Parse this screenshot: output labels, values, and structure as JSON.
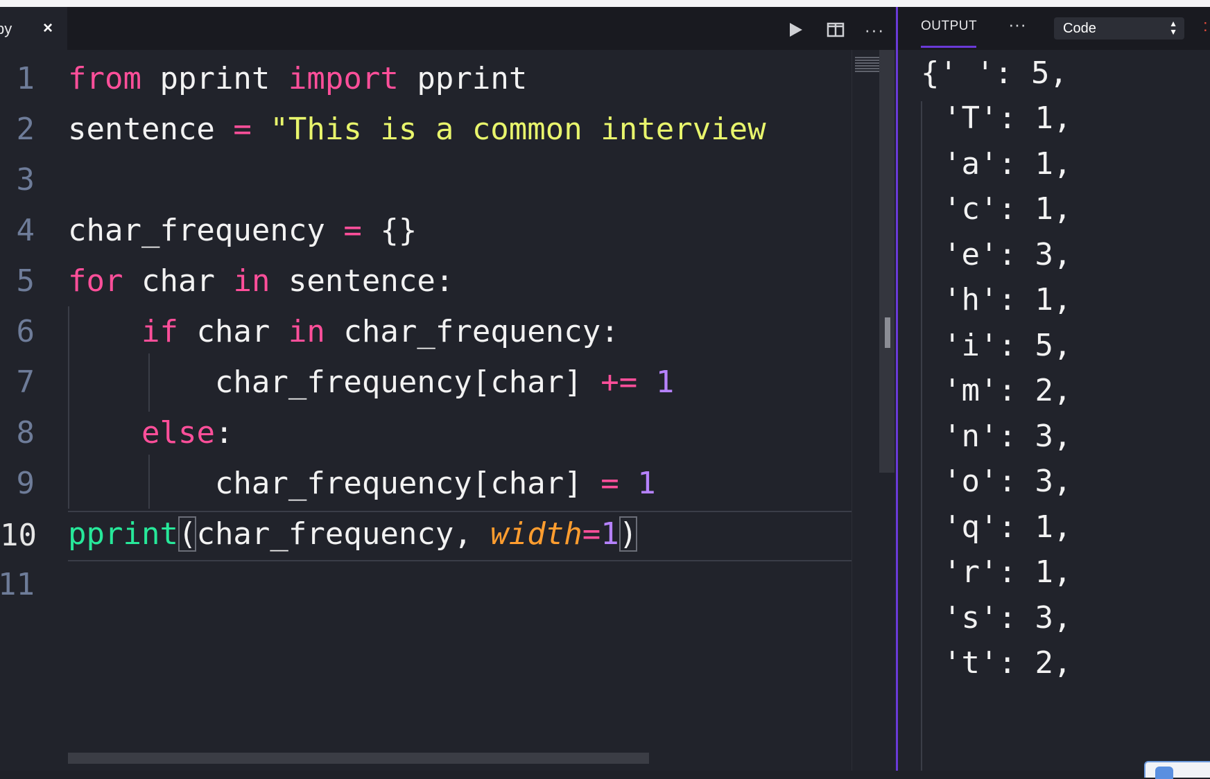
{
  "editor": {
    "tab": {
      "label": "py",
      "close_glyph": "×"
    },
    "toolbar": {
      "run_icon": "play-icon",
      "split_icon": "split-view-icon",
      "more_label": "···"
    },
    "lines": [
      {
        "n": "1"
      },
      {
        "n": "2"
      },
      {
        "n": "3"
      },
      {
        "n": "4"
      },
      {
        "n": "5"
      },
      {
        "n": "6"
      },
      {
        "n": "7"
      },
      {
        "n": "8"
      },
      {
        "n": "9"
      },
      {
        "n": "10"
      },
      {
        "n": "11"
      }
    ],
    "code": {
      "l1": {
        "from": "from",
        "mod": "pprint",
        "import": "import",
        "name": "pprint"
      },
      "l2": {
        "var": "sentence",
        "eq": "=",
        "str": "\"This is a common interview"
      },
      "l4": {
        "var": "char_frequency",
        "eq": "=",
        "rest": "{}"
      },
      "l5": {
        "for": "for",
        "var": "char",
        "in": "in",
        "iter": "sentence:"
      },
      "l6": {
        "if": "if",
        "var": "char",
        "in": "in",
        "obj": "char_frequency:"
      },
      "l7": {
        "target": "char_frequency[char]",
        "op": "+=",
        "num": "1"
      },
      "l8": {
        "else": "else",
        "colon": ":"
      },
      "l9": {
        "target": "char_frequency[char]",
        "op": "=",
        "num": "1"
      },
      "l10": {
        "fn": "pprint",
        "open": "(",
        "arg": "char_frequency, ",
        "param": "width",
        "eq": "=",
        "num": "1",
        "close": ")"
      }
    }
  },
  "output": {
    "tab_label": "OUTPUT",
    "more_label": "···",
    "select_value": "Code",
    "lines": [
      "{' ': 5,",
      "'T': 1,",
      "'a': 1,",
      "'c': 1,",
      "'e': 3,",
      "'h': 1,",
      "'i': 5,",
      "'m': 2,",
      "'n': 3,",
      "'o': 3,",
      "'q': 1,",
      "'r': 1,",
      "'s': 3,",
      "'t': 2,"
    ]
  },
  "colors": {
    "accent": "#6a3ad8",
    "keyword": "#ff4f9a",
    "string": "#e8f56c",
    "number": "#b682ff",
    "function": "#27e89a",
    "parameter": "#ff9d2f"
  }
}
